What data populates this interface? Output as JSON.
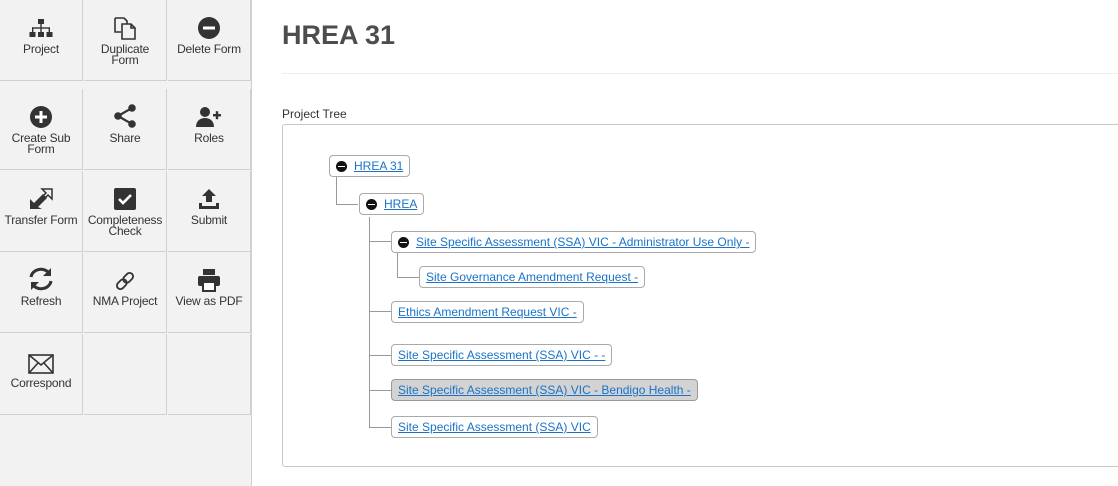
{
  "toolbar": {
    "project": "Project",
    "duplicate_form": "Duplicate\nForm",
    "delete_form": "Delete Form",
    "create_sub_form": "Create Sub\nForm",
    "share": "Share",
    "roles": "Roles",
    "transfer_form": "Transfer Form",
    "completeness_check": "Completeness\nCheck",
    "submit": "Submit",
    "refresh": "Refresh",
    "nma_project": "NMA Project",
    "view_as_pdf": "View as PDF",
    "correspond": "Correspond"
  },
  "page": {
    "title": "HREA 31",
    "tree_label": "Project Tree"
  },
  "tree": {
    "root": "HREA 31",
    "hrea": "HREA",
    "ssa_admin": "Site Specific Assessment (SSA) VIC - Administrator Use Only -",
    "site_governance": "Site Governance Amendment Request -",
    "ethics_amendment": "Ethics Amendment Request VIC -",
    "ssa_dash": "Site Specific Assessment (SSA) VIC - -",
    "ssa_bendigo": "Site Specific Assessment (SSA) VIC - Bendigo Health -",
    "ssa_vic": "Site Specific Assessment (SSA) VIC"
  },
  "colors": {
    "link": "#1a73c8",
    "selected_bg": "#d3d3d3",
    "icon": "#333333"
  }
}
